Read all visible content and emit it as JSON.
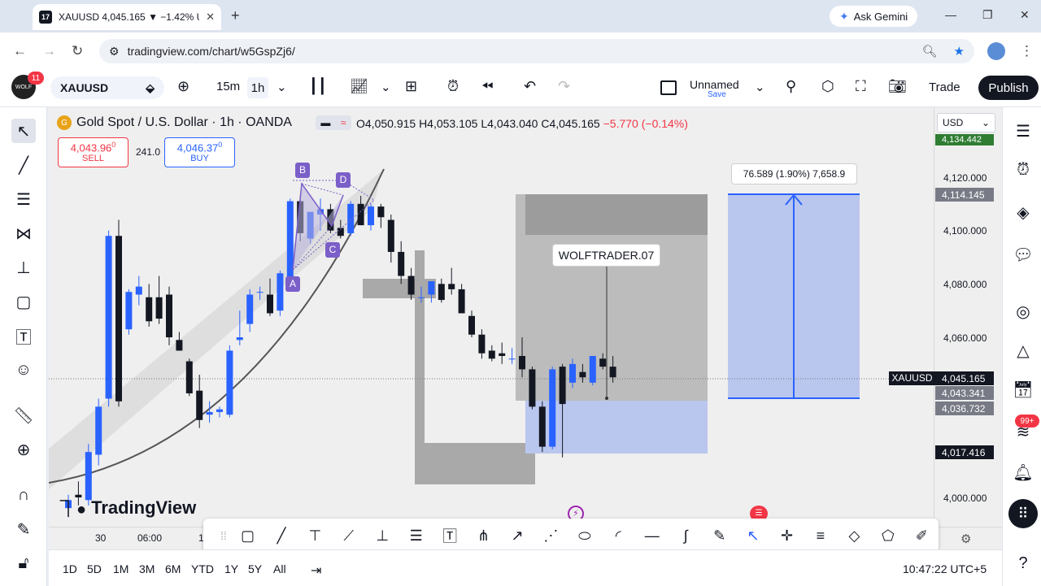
{
  "browser": {
    "tab_title": "XAUUSD 4,045.165 ▼ −1.42% U",
    "url": "tradingview.com/chart/w5GspZj6/",
    "gemini_label": "Ask Gemini"
  },
  "header": {
    "notifications": "11",
    "symbol": "XAUUSD",
    "intervals": [
      "15m",
      "1h"
    ],
    "layout_name": "Unnamed",
    "layout_save": "Save",
    "trade_label": "Trade",
    "publish_label": "Publish"
  },
  "legend": {
    "title": "Gold Spot / U.S. Dollar · 1h · OANDA",
    "open": "O4,050.915",
    "high": "H4,053.105",
    "low": "L4,043.040",
    "close": "C4,045.165",
    "change": "−5.770 (−0.14%)"
  },
  "trade": {
    "sell_price": "4,043.96",
    "sell_sup": "0",
    "sell_label": "SELL",
    "spread": "241.0",
    "buy_price": "4,046.37",
    "buy_sup": "0",
    "buy_label": "BUY"
  },
  "annotations": {
    "text_box": "WOLFTRADER.07",
    "measure": "76.589 (1.90%) 7,658.9",
    "harmonic_points": [
      "A",
      "B",
      "C",
      "D"
    ]
  },
  "price_scale": {
    "currency": "USD",
    "labels": [
      "4,120.000",
      "4,100.000",
      "4,080.000",
      "4,060.000",
      "4,000.000"
    ],
    "badge_top": "4,134.442",
    "badge_target": "4,114.145",
    "badge_last": "4,045.165",
    "badge_symbol": "XAUUSD",
    "badge_entry": "4,043.341",
    "badge_stop": "4,036.732",
    "badge_low": "4,017.416"
  },
  "time_scale": {
    "labels": [
      "30",
      "06:00",
      "1"
    ]
  },
  "bottom_bar": {
    "ranges": [
      "1D",
      "5D",
      "1M",
      "3M",
      "6M",
      "YTD",
      "1Y",
      "5Y",
      "All"
    ],
    "clock": "10:47:22 UTC+5"
  },
  "right_badge": "99+",
  "logo_text": "TradingView",
  "colors": {
    "bull": "#2962ff",
    "bear": "#131722",
    "sell": "#f23645",
    "buy": "#2962ff",
    "target_zone": "#b9c6ee",
    "last_price_badge": "#131722"
  },
  "chart_data": {
    "type": "candlestick",
    "symbol": "XAUUSD",
    "interval": "1h",
    "candles": [
      {
        "o": 3996,
        "h": 4001,
        "l": 3995,
        "c": 3999
      },
      {
        "o": 4001,
        "h": 4006,
        "l": 3997,
        "c": 4000
      },
      {
        "o": 3999,
        "h": 4020,
        "l": 3997,
        "c": 4017
      },
      {
        "o": 4016,
        "h": 4037,
        "l": 4012,
        "c": 4034
      },
      {
        "o": 4037,
        "h": 4100,
        "l": 4034,
        "c": 4098
      },
      {
        "o": 4098,
        "h": 4104,
        "l": 4034,
        "c": 4036
      },
      {
        "o": 4063,
        "h": 4078,
        "l": 4061,
        "c": 4077
      },
      {
        "o": 4076,
        "h": 4083,
        "l": 4072,
        "c": 4079
      },
      {
        "o": 4075,
        "h": 4080,
        "l": 4064,
        "c": 4066
      },
      {
        "o": 4075,
        "h": 4083,
        "l": 4065,
        "c": 4067
      },
      {
        "o": 4076,
        "h": 4079,
        "l": 4057,
        "c": 4060
      },
      {
        "o": 4059,
        "h": 4062,
        "l": 4055,
        "c": 4055
      },
      {
        "o": 4051,
        "h": 4052,
        "l": 4038,
        "c": 4039
      },
      {
        "o": 4040,
        "h": 4046,
        "l": 4026,
        "c": 4029
      },
      {
        "o": 4031,
        "h": 4036,
        "l": 4028,
        "c": 4032
      },
      {
        "o": 4032,
        "h": 4034,
        "l": 4030,
        "c": 4033
      },
      {
        "o": 4031,
        "h": 4057,
        "l": 4030,
        "c": 4055
      },
      {
        "o": 4059,
        "h": 4070,
        "l": 4057,
        "c": 4060
      },
      {
        "o": 4065,
        "h": 4078,
        "l": 4062,
        "c": 4076
      },
      {
        "o": 4077,
        "h": 4079,
        "l": 4074,
        "c": 4077
      },
      {
        "o": 4076,
        "h": 4082,
        "l": 4068,
        "c": 4069
      },
      {
        "o": 4070,
        "h": 4085,
        "l": 4068,
        "c": 4084
      },
      {
        "o": 4081,
        "h": 4112,
        "l": 4079,
        "c": 4111
      },
      {
        "o": 4111,
        "h": 4113,
        "l": 4096,
        "c": 4099
      },
      {
        "o": 4097,
        "h": 4106,
        "l": 4095,
        "c": 4107
      },
      {
        "o": 4106,
        "h": 4112,
        "l": 4100,
        "c": 4108
      },
      {
        "o": 4108,
        "h": 4110,
        "l": 4099,
        "c": 4100
      },
      {
        "o": 4101,
        "h": 4104,
        "l": 4097,
        "c": 4098
      },
      {
        "o": 4099,
        "h": 4111,
        "l": 4098,
        "c": 4110
      },
      {
        "o": 4110,
        "h": 4113,
        "l": 4102,
        "c": 4102
      },
      {
        "o": 4102,
        "h": 4110,
        "l": 4100,
        "c": 4109
      },
      {
        "o": 4109,
        "h": 4110,
        "l": 4101,
        "c": 4105
      },
      {
        "o": 4104,
        "h": 4106,
        "l": 4088,
        "c": 4092
      },
      {
        "o": 4092,
        "h": 4096,
        "l": 4080,
        "c": 4083
      },
      {
        "o": 4083,
        "h": 4086,
        "l": 4074,
        "c": 4076
      },
      {
        "o": 4075,
        "h": 4079,
        "l": 4073,
        "c": 4075
      },
      {
        "o": 4076,
        "h": 4081,
        "l": 4073,
        "c": 4081
      },
      {
        "o": 4080,
        "h": 4082,
        "l": 4073,
        "c": 4074
      },
      {
        "o": 4080,
        "h": 4086,
        "l": 4076,
        "c": 4078
      },
      {
        "o": 4078,
        "h": 4080,
        "l": 4069,
        "c": 4069
      },
      {
        "o": 4068,
        "h": 4070,
        "l": 4060,
        "c": 4061
      },
      {
        "o": 4061,
        "h": 4063,
        "l": 4052,
        "c": 4054
      },
      {
        "o": 4055,
        "h": 4057,
        "l": 4051,
        "c": 4052
      },
      {
        "o": 4054,
        "h": 4058,
        "l": 4050,
        "c": 4053
      },
      {
        "o": 4052,
        "h": 4056,
        "l": 4050,
        "c": 4052
      },
      {
        "o": 4053,
        "h": 4060,
        "l": 4045,
        "c": 4048
      },
      {
        "o": 4048,
        "h": 4049,
        "l": 4033,
        "c": 4034
      },
      {
        "o": 4034,
        "h": 4036,
        "l": 4017,
        "c": 4019
      },
      {
        "o": 4019,
        "h": 4049,
        "l": 4018,
        "c": 4048
      },
      {
        "o": 4049,
        "h": 4050,
        "l": 4015,
        "c": 4035
      },
      {
        "o": 4043,
        "h": 4052,
        "l": 4041,
        "c": 4050
      },
      {
        "o": 4047,
        "h": 4050,
        "l": 4043,
        "c": 4045
      },
      {
        "o": 4043,
        "h": 4053,
        "l": 4042,
        "c": 4053
      },
      {
        "o": 4052,
        "h": 4054,
        "l": 4048,
        "c": 4049
      },
      {
        "o": 4049,
        "h": 4053,
        "l": 4043,
        "c": 4045
      }
    ],
    "yticks": [
      4120,
      4100,
      4080,
      4060,
      4000
    ],
    "last_price": 4045.165
  }
}
